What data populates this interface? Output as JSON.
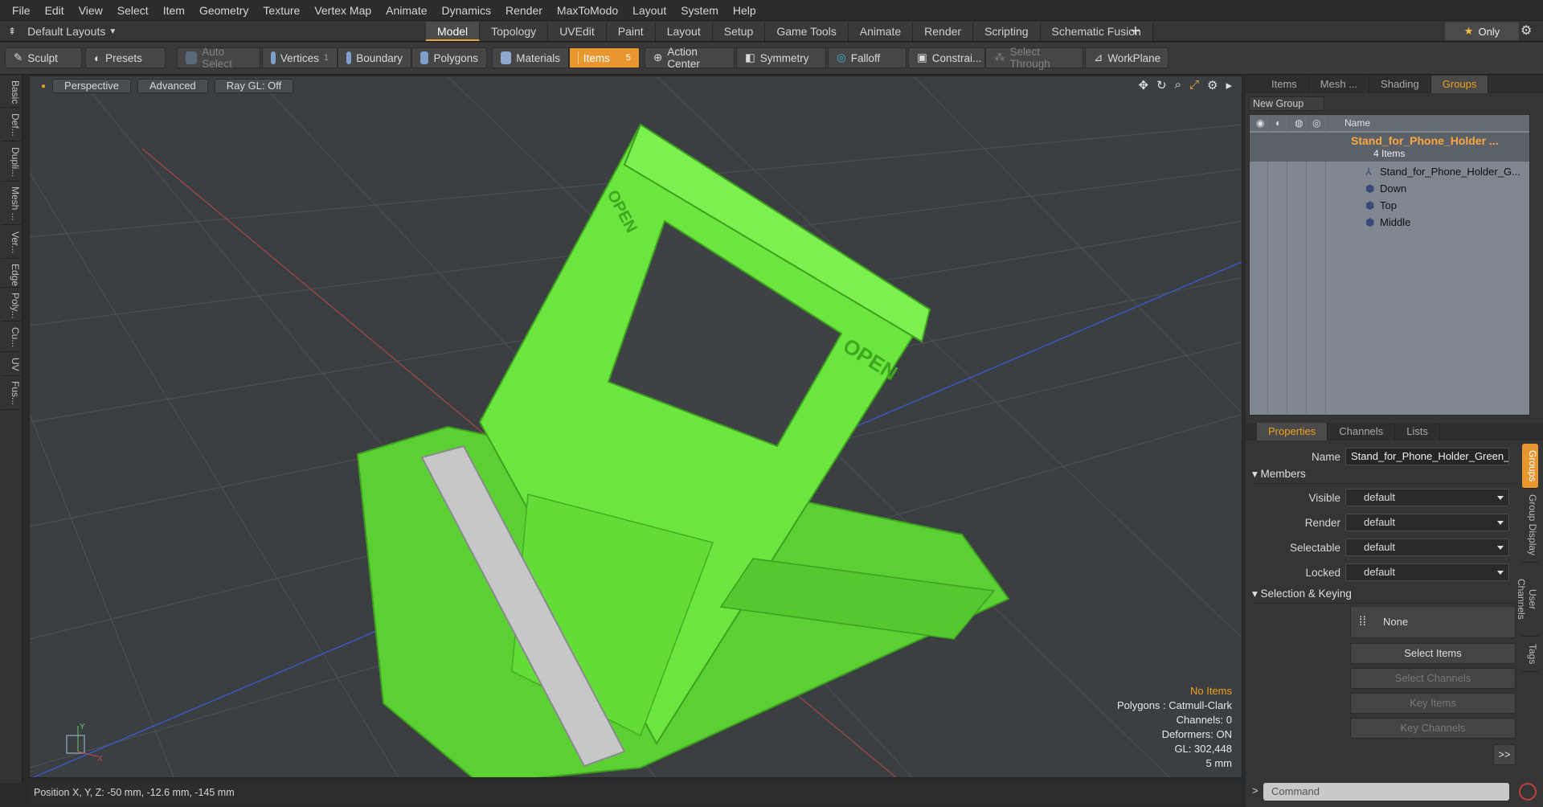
{
  "menu": [
    "File",
    "Edit",
    "View",
    "Select",
    "Item",
    "Geometry",
    "Texture",
    "Vertex Map",
    "Animate",
    "Dynamics",
    "Render",
    "MaxToModo",
    "Layout",
    "System",
    "Help"
  ],
  "layout_selector": "Default Layouts",
  "layout_tabs": [
    {
      "label": "Model",
      "active": true
    },
    {
      "label": "Topology"
    },
    {
      "label": "UVEdit"
    },
    {
      "label": "Paint"
    },
    {
      "label": "Layout"
    },
    {
      "label": "Setup"
    },
    {
      "label": "Game Tools"
    },
    {
      "label": "Animate"
    },
    {
      "label": "Render"
    },
    {
      "label": "Scripting"
    },
    {
      "label": "Schematic Fusion"
    }
  ],
  "only_label": "Only",
  "toolbar": {
    "sculpt": "Sculpt",
    "presets": "Presets",
    "auto_select": "Auto Select",
    "vertices": "Vertices",
    "vertices_count": "1",
    "boundary": "Boundary",
    "polygons": "Polygons",
    "materials": "Materials",
    "items": "Items",
    "items_count": "5",
    "action_center": "Action Center",
    "symmetry": "Symmetry",
    "falloff": "Falloff",
    "constraints": "Constrai...",
    "select_through": "Select Through",
    "workplane": "WorkPlane"
  },
  "left_tabs": [
    "Basic",
    "Def...",
    "Dupli...",
    "Mesh ...",
    "Ver...",
    "Edge",
    "Poly...",
    "Cu...",
    "UV",
    "Fus..."
  ],
  "viewport": {
    "view": "Perspective",
    "shading": "Advanced",
    "raygl": "Ray GL: Off",
    "hud": {
      "selection": "No Items",
      "polygons": "Polygons : Catmull-Clark",
      "channels": "Channels: 0",
      "deformers": "Deformers: ON",
      "gl": "GL: 302,448",
      "scale": "5 mm"
    },
    "model_label": "OPEN",
    "colors": {
      "model": "#66e23c",
      "background": "#3c3f42",
      "axis_x": "#c34a4a",
      "axis_z": "#3a58c8"
    }
  },
  "status": "Position X, Y, Z:  -50 mm, -12.6 mm, -145 mm",
  "right": {
    "tabs": [
      {
        "label": "Items"
      },
      {
        "label": "Mesh ..."
      },
      {
        "label": "Shading"
      },
      {
        "label": "Groups",
        "active": true
      }
    ],
    "new_group": "New Group",
    "tree_header": "Name",
    "group_name": "Stand_for_Phone_Holder ...",
    "group_count": "4 Items",
    "children": [
      "Stand_for_Phone_Holder_G...",
      "Down",
      "Top",
      "Middle"
    ]
  },
  "properties": {
    "tabs": [
      {
        "label": "Properties",
        "active": true
      },
      {
        "label": "Channels"
      },
      {
        "label": "Lists"
      }
    ],
    "name_label": "Name",
    "name_value": "Stand_for_Phone_Holder_Green_",
    "members": "Members",
    "visible_label": "Visible",
    "render_label": "Render",
    "selectable_label": "Selectable",
    "locked_label": "Locked",
    "default": "default",
    "selection_keying": "Selection & Keying",
    "none": "None",
    "select_items": "Select Items",
    "select_channels": "Select Channels",
    "key_items": "Key Items",
    "key_channels": "Key Channels",
    "more": ">>",
    "side_tabs": [
      "Groups",
      "Group Display",
      "User Channels",
      "Tags"
    ]
  },
  "command_placeholder": "Command"
}
